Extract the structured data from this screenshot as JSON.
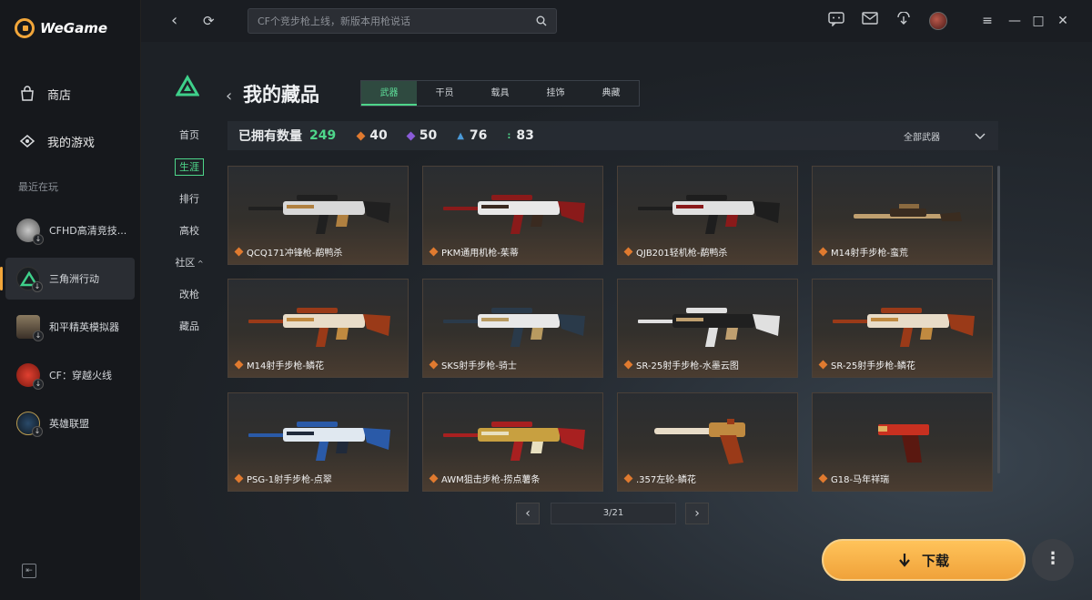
{
  "app": {
    "name": "WeGame"
  },
  "sidebar": {
    "nav": [
      {
        "label": "商店",
        "icon": "shop-bag-icon"
      },
      {
        "label": "我的游戏",
        "icon": "gamepad-icon"
      }
    ],
    "recent_label": "最近在玩",
    "games": [
      {
        "label": "CFHD高清竞技...",
        "icon": "cfhd-icon",
        "active": false
      },
      {
        "label": "三角洲行动",
        "icon": "delta-force-icon",
        "active": true
      },
      {
        "label": "和平精英模拟器",
        "icon": "peace-elite-icon",
        "active": false
      },
      {
        "label": "CF：穿越火线",
        "icon": "crossfire-icon",
        "active": false
      },
      {
        "label": "英雄联盟",
        "icon": "lol-icon",
        "active": false
      }
    ]
  },
  "topbar": {
    "search_placeholder": "CF个竞步枪上线，新版本用枪说话"
  },
  "subnav": [
    "首页",
    "生涯",
    "排行",
    "高校",
    "社区",
    "改枪",
    "藏品"
  ],
  "subnav_active": "生涯",
  "page": {
    "title": "我的藏品",
    "tabs": [
      "武器",
      "干员",
      "载具",
      "挂饰",
      "典藏"
    ],
    "active_tab": "武器"
  },
  "stats": {
    "owned_label": "已拥有数量",
    "owned_total": "249",
    "items": [
      {
        "value": "40",
        "color": "#e07a2f",
        "icon": "orange-diamond-icon"
      },
      {
        "value": "50",
        "color": "#8a5bd8",
        "icon": "purple-diamond-icon"
      },
      {
        "value": "76",
        "color": "#4a9ad8",
        "icon": "blue-rank-icon"
      },
      {
        "value": "83",
        "color": "#4ed68a",
        "icon": "green-dots-icon"
      }
    ],
    "filter_label": "全部武器"
  },
  "weapons": [
    {
      "name": "QCQ171冲锋枪-鹬鸭杀",
      "palette": [
        "#d8d8d8",
        "#202020",
        "#b08040"
      ]
    },
    {
      "name": "PKM通用机枪-茱蒂",
      "palette": [
        "#e8e8e8",
        "#8a1a1a",
        "#3a2a20"
      ]
    },
    {
      "name": "QJB201轻机枪-鹬鸭杀",
      "palette": [
        "#e0e0e0",
        "#1e1e1e",
        "#8a1a1a"
      ]
    },
    {
      "name": "M14射手步枪-蛮荒",
      "palette": [
        "#8a6a40",
        "#3a2c20",
        "#c0a070"
      ]
    },
    {
      "name": "M14射手步枪-鳞花",
      "palette": [
        "#e8dcc8",
        "#9a3a18",
        "#c08a40"
      ]
    },
    {
      "name": "SKS射手步枪-骑士",
      "palette": [
        "#e8e8e8",
        "#2a3a4a",
        "#b89a60"
      ]
    },
    {
      "name": "SR-25射手步枪-水墨云图",
      "palette": [
        "#202020",
        "#e0e0e0",
        "#c0a070"
      ]
    },
    {
      "name": "SR-25射手步枪-鳞花",
      "palette": [
        "#e8dcc8",
        "#9a3a18",
        "#c08a40"
      ]
    },
    {
      "name": "PSG-1射手步枪-点翠",
      "palette": [
        "#e0e8f0",
        "#2a5aa8",
        "#202a3a"
      ]
    },
    {
      "name": "AWM狙击步枪-捞点薯条",
      "palette": [
        "#c8a040",
        "#a82020",
        "#e8e0c0"
      ]
    },
    {
      "name": ".357左轮-鳞花",
      "palette": [
        "#e8dcc8",
        "#9a3a18",
        "#c08a40"
      ]
    },
    {
      "name": "G18-马年祥瑞",
      "palette": [
        "#c83020",
        "#5a1810",
        "#e0b060"
      ]
    }
  ],
  "pager": {
    "label": "3/21"
  },
  "download": {
    "label": "下载"
  }
}
